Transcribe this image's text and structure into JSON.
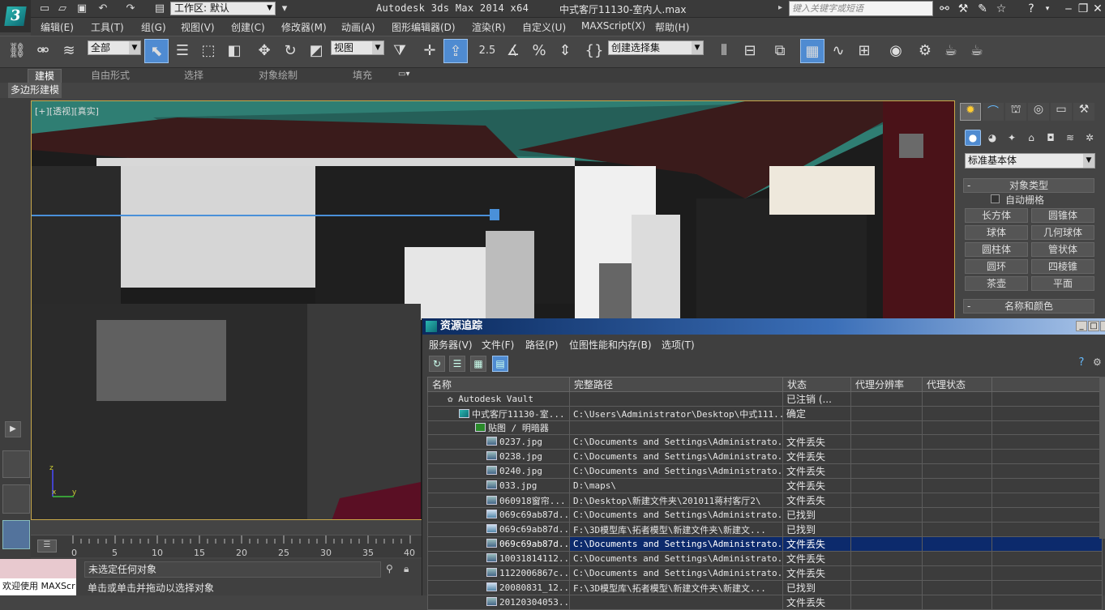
{
  "titlebar": {
    "workspace": "工作区: 默认",
    "app_title": "Autodesk 3ds Max  2014 x64",
    "doc_title": "中式客厅11130-室内人.max",
    "search_placeholder": "键入关键字或短语"
  },
  "menu": [
    "编辑(E)",
    "工具(T)",
    "组(G)",
    "视图(V)",
    "创建(C)",
    "修改器(M)",
    "动画(A)",
    "图形编辑器(D)",
    "渲染(R)",
    "自定义(U)",
    "MAXScript(X)",
    "帮助(H)"
  ],
  "toolbar": {
    "selection_filter": "全部",
    "ref_coord": "视图",
    "named_selection": "创建选择集",
    "snap_label": "2.5"
  },
  "ribbon": {
    "tabs": [
      "建模",
      "自由形式",
      "选择",
      "对象绘制",
      "填充"
    ],
    "subtab": "多边形建模"
  },
  "viewport": {
    "label": "[+][透视][真实]",
    "axis_x": "x",
    "axis_y": "y",
    "axis_z": "z"
  },
  "command_panel": {
    "dropdown": "标准基本体",
    "object_type_title": "对象类型",
    "auto_grid": "自动栅格",
    "buttons": [
      "长方体",
      "圆锥体",
      "球体",
      "几何球体",
      "圆柱体",
      "管状体",
      "圆环",
      "四棱锥",
      "茶壶",
      "平面"
    ],
    "name_color_title": "名称和颜色"
  },
  "timeline": {
    "ticks": [
      "0",
      "5",
      "10",
      "15",
      "20",
      "25",
      "30",
      "35",
      "40"
    ]
  },
  "status": {
    "script_label": "欢迎使用 MAXScr",
    "selection": "未选定任何对象",
    "prompt": "单击或单击并拖动以选择对象"
  },
  "asset_tracking": {
    "title": "资源追踪",
    "menu": [
      "服务器(V)",
      "文件(F)",
      "路径(P)",
      "位图性能和内存(B)",
      "选项(T)"
    ],
    "columns": [
      "名称",
      "完整路径",
      "状态",
      "代理分辨率",
      "代理状态"
    ],
    "rows": [
      {
        "name": "Autodesk Vault",
        "path": "",
        "status": "已注销 (..."
      },
      {
        "name": "中式客厅11130-室...",
        "path": "C:\\Users\\Administrator\\Desktop\\中式111...",
        "status": "确定"
      },
      {
        "name": "贴图 / 明暗器",
        "path": "",
        "status": ""
      },
      {
        "name": "0237.jpg",
        "path": "C:\\Documents and Settings\\Administrato...",
        "status": "文件丢失"
      },
      {
        "name": "0238.jpg",
        "path": "C:\\Documents and Settings\\Administrato...",
        "status": "文件丢失"
      },
      {
        "name": "0240.jpg",
        "path": "C:\\Documents and Settings\\Administrato...",
        "status": "文件丢失"
      },
      {
        "name": "033.jpg",
        "path": "D:\\maps\\",
        "status": "文件丢失"
      },
      {
        "name": "060918窗帘...",
        "path": "D:\\Desktop\\新建文件夹\\201011蒋村客厅2\\",
        "status": "文件丢失"
      },
      {
        "name": "069c69ab87d...",
        "path": "C:\\Documents and Settings\\Administrato...",
        "status": "已找到"
      },
      {
        "name": "069c69ab87d...",
        "path": "F:\\3D模型库\\拓者模型\\新建文件夹\\新建文...",
        "status": "已找到"
      },
      {
        "name": "069c69ab87d...",
        "path": "C:\\Documents and Settings\\Administrato...",
        "status": "文件丢失"
      },
      {
        "name": "10031814112...",
        "path": "C:\\Documents and Settings\\Administrato...",
        "status": "文件丢失"
      },
      {
        "name": "1122006867c...",
        "path": "C:\\Documents and Settings\\Administrato...",
        "status": "文件丢失"
      },
      {
        "name": "20080831_12...",
        "path": "F:\\3D模型库\\拓者模型\\新建文件夹\\新建文...",
        "status": "已找到"
      },
      {
        "name": "20120304053...",
        "path": "",
        "status": "文件丢失"
      }
    ]
  }
}
